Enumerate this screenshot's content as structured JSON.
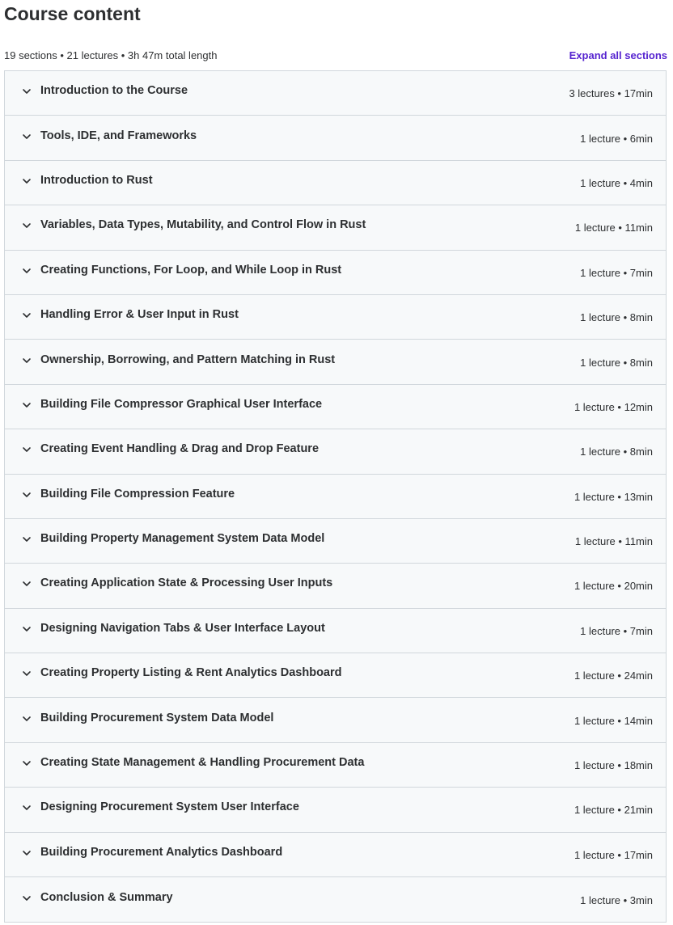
{
  "header": {
    "title": "Course content",
    "summary": "19 sections • 21 lectures • 3h 47m total length",
    "expand_label": "Expand all sections"
  },
  "sections": [
    {
      "title": "Introduction to the Course",
      "meta": "3 lectures • 17min"
    },
    {
      "title": "Tools, IDE, and Frameworks",
      "meta": "1 lecture • 6min"
    },
    {
      "title": "Introduction to Rust",
      "meta": "1 lecture • 4min"
    },
    {
      "title": "Variables, Data Types, Mutability, and Control Flow in Rust",
      "meta": "1 lecture • 11min"
    },
    {
      "title": "Creating Functions, For Loop, and While Loop in Rust",
      "meta": "1 lecture • 7min"
    },
    {
      "title": "Handling Error & User Input in Rust",
      "meta": "1 lecture • 8min"
    },
    {
      "title": "Ownership, Borrowing, and Pattern Matching in Rust",
      "meta": "1 lecture • 8min"
    },
    {
      "title": "Building File Compressor Graphical User Interface",
      "meta": "1 lecture • 12min"
    },
    {
      "title": "Creating Event Handling & Drag and Drop Feature",
      "meta": "1 lecture • 8min"
    },
    {
      "title": "Building File Compression Feature",
      "meta": "1 lecture • 13min"
    },
    {
      "title": "Building Property Management System Data Model",
      "meta": "1 lecture • 11min"
    },
    {
      "title": "Creating Application State & Processing User Inputs",
      "meta": "1 lecture • 20min"
    },
    {
      "title": "Designing Navigation Tabs & User Interface Layout",
      "meta": "1 lecture • 7min"
    },
    {
      "title": "Creating Property Listing & Rent Analytics Dashboard",
      "meta": "1 lecture • 24min"
    },
    {
      "title": "Building Procurement System Data Model",
      "meta": "1 lecture • 14min"
    },
    {
      "title": "Creating State Management & Handling Procurement Data",
      "meta": "1 lecture • 18min"
    },
    {
      "title": "Designing Procurement System User Interface",
      "meta": "1 lecture • 21min"
    },
    {
      "title": "Building Procurement Analytics Dashboard",
      "meta": "1 lecture • 17min"
    },
    {
      "title": "Conclusion & Summary",
      "meta": "1 lecture • 3min"
    }
  ],
  "icons": {
    "section_toggle": "chevron-down-icon"
  },
  "colors": {
    "accent": "#5624d0",
    "text": "#2d2f31",
    "section_bg": "#f7f9fa",
    "border": "#d1d7dc"
  }
}
